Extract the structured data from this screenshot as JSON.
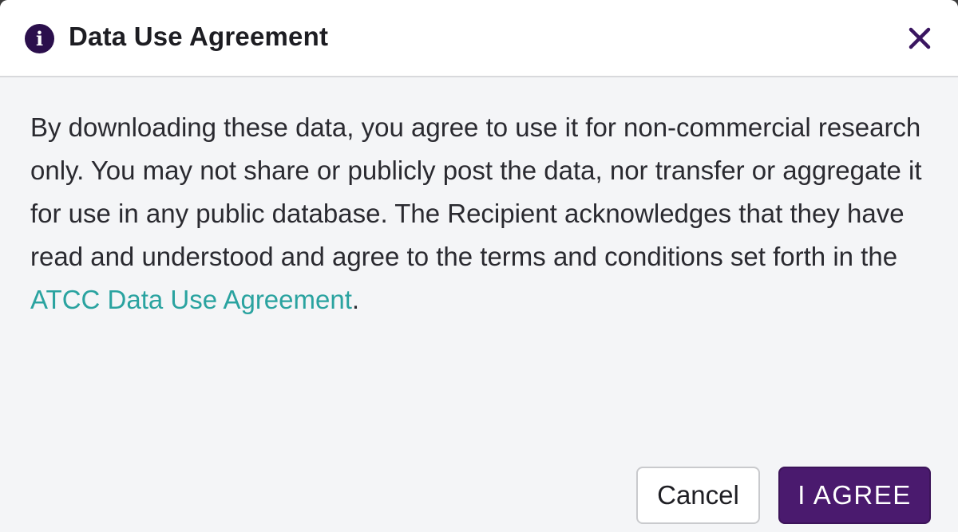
{
  "dialog": {
    "title": "Data Use Agreement",
    "info_icon": "info-icon",
    "close_icon": "close-icon",
    "body": {
      "text_before_link": "By downloading these data, you agree to use it for non-commercial research only. You may not share or publicly post the data, nor transfer or aggregate it for use in any public database. The Recipient acknowledges that they have read and understood and agree to the terms and conditions set forth in the ",
      "link_text": "ATCC Data Use Agreement",
      "text_after_link": "."
    },
    "buttons": {
      "cancel_label": "Cancel",
      "agree_label": "I AGREE"
    }
  },
  "colors": {
    "accent": "#4a1a6e",
    "link": "#2aa3a0",
    "icon": "#2b0f4c"
  }
}
